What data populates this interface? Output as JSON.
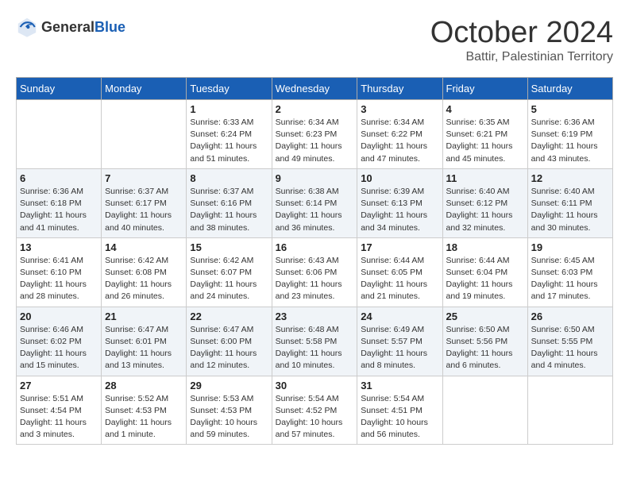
{
  "header": {
    "logo_general": "General",
    "logo_blue": "Blue",
    "month": "October 2024",
    "location": "Battir, Palestinian Territory"
  },
  "days_of_week": [
    "Sunday",
    "Monday",
    "Tuesday",
    "Wednesday",
    "Thursday",
    "Friday",
    "Saturday"
  ],
  "weeks": [
    {
      "days": [
        {
          "num": "",
          "empty": true
        },
        {
          "num": "",
          "empty": true
        },
        {
          "num": "1",
          "sunrise": "Sunrise: 6:33 AM",
          "sunset": "Sunset: 6:24 PM",
          "daylight": "Daylight: 11 hours and 51 minutes."
        },
        {
          "num": "2",
          "sunrise": "Sunrise: 6:34 AM",
          "sunset": "Sunset: 6:23 PM",
          "daylight": "Daylight: 11 hours and 49 minutes."
        },
        {
          "num": "3",
          "sunrise": "Sunrise: 6:34 AM",
          "sunset": "Sunset: 6:22 PM",
          "daylight": "Daylight: 11 hours and 47 minutes."
        },
        {
          "num": "4",
          "sunrise": "Sunrise: 6:35 AM",
          "sunset": "Sunset: 6:21 PM",
          "daylight": "Daylight: 11 hours and 45 minutes."
        },
        {
          "num": "5",
          "sunrise": "Sunrise: 6:36 AM",
          "sunset": "Sunset: 6:19 PM",
          "daylight": "Daylight: 11 hours and 43 minutes."
        }
      ]
    },
    {
      "days": [
        {
          "num": "6",
          "sunrise": "Sunrise: 6:36 AM",
          "sunset": "Sunset: 6:18 PM",
          "daylight": "Daylight: 11 hours and 41 minutes."
        },
        {
          "num": "7",
          "sunrise": "Sunrise: 6:37 AM",
          "sunset": "Sunset: 6:17 PM",
          "daylight": "Daylight: 11 hours and 40 minutes."
        },
        {
          "num": "8",
          "sunrise": "Sunrise: 6:37 AM",
          "sunset": "Sunset: 6:16 PM",
          "daylight": "Daylight: 11 hours and 38 minutes."
        },
        {
          "num": "9",
          "sunrise": "Sunrise: 6:38 AM",
          "sunset": "Sunset: 6:14 PM",
          "daylight": "Daylight: 11 hours and 36 minutes."
        },
        {
          "num": "10",
          "sunrise": "Sunrise: 6:39 AM",
          "sunset": "Sunset: 6:13 PM",
          "daylight": "Daylight: 11 hours and 34 minutes."
        },
        {
          "num": "11",
          "sunrise": "Sunrise: 6:40 AM",
          "sunset": "Sunset: 6:12 PM",
          "daylight": "Daylight: 11 hours and 32 minutes."
        },
        {
          "num": "12",
          "sunrise": "Sunrise: 6:40 AM",
          "sunset": "Sunset: 6:11 PM",
          "daylight": "Daylight: 11 hours and 30 minutes."
        }
      ]
    },
    {
      "days": [
        {
          "num": "13",
          "sunrise": "Sunrise: 6:41 AM",
          "sunset": "Sunset: 6:10 PM",
          "daylight": "Daylight: 11 hours and 28 minutes."
        },
        {
          "num": "14",
          "sunrise": "Sunrise: 6:42 AM",
          "sunset": "Sunset: 6:08 PM",
          "daylight": "Daylight: 11 hours and 26 minutes."
        },
        {
          "num": "15",
          "sunrise": "Sunrise: 6:42 AM",
          "sunset": "Sunset: 6:07 PM",
          "daylight": "Daylight: 11 hours and 24 minutes."
        },
        {
          "num": "16",
          "sunrise": "Sunrise: 6:43 AM",
          "sunset": "Sunset: 6:06 PM",
          "daylight": "Daylight: 11 hours and 23 minutes."
        },
        {
          "num": "17",
          "sunrise": "Sunrise: 6:44 AM",
          "sunset": "Sunset: 6:05 PM",
          "daylight": "Daylight: 11 hours and 21 minutes."
        },
        {
          "num": "18",
          "sunrise": "Sunrise: 6:44 AM",
          "sunset": "Sunset: 6:04 PM",
          "daylight": "Daylight: 11 hours and 19 minutes."
        },
        {
          "num": "19",
          "sunrise": "Sunrise: 6:45 AM",
          "sunset": "Sunset: 6:03 PM",
          "daylight": "Daylight: 11 hours and 17 minutes."
        }
      ]
    },
    {
      "days": [
        {
          "num": "20",
          "sunrise": "Sunrise: 6:46 AM",
          "sunset": "Sunset: 6:02 PM",
          "daylight": "Daylight: 11 hours and 15 minutes."
        },
        {
          "num": "21",
          "sunrise": "Sunrise: 6:47 AM",
          "sunset": "Sunset: 6:01 PM",
          "daylight": "Daylight: 11 hours and 13 minutes."
        },
        {
          "num": "22",
          "sunrise": "Sunrise: 6:47 AM",
          "sunset": "Sunset: 6:00 PM",
          "daylight": "Daylight: 11 hours and 12 minutes."
        },
        {
          "num": "23",
          "sunrise": "Sunrise: 6:48 AM",
          "sunset": "Sunset: 5:58 PM",
          "daylight": "Daylight: 11 hours and 10 minutes."
        },
        {
          "num": "24",
          "sunrise": "Sunrise: 6:49 AM",
          "sunset": "Sunset: 5:57 PM",
          "daylight": "Daylight: 11 hours and 8 minutes."
        },
        {
          "num": "25",
          "sunrise": "Sunrise: 6:50 AM",
          "sunset": "Sunset: 5:56 PM",
          "daylight": "Daylight: 11 hours and 6 minutes."
        },
        {
          "num": "26",
          "sunrise": "Sunrise: 6:50 AM",
          "sunset": "Sunset: 5:55 PM",
          "daylight": "Daylight: 11 hours and 4 minutes."
        }
      ]
    },
    {
      "days": [
        {
          "num": "27",
          "sunrise": "Sunrise: 5:51 AM",
          "sunset": "Sunset: 4:54 PM",
          "daylight": "Daylight: 11 hours and 3 minutes."
        },
        {
          "num": "28",
          "sunrise": "Sunrise: 5:52 AM",
          "sunset": "Sunset: 4:53 PM",
          "daylight": "Daylight: 11 hours and 1 minute."
        },
        {
          "num": "29",
          "sunrise": "Sunrise: 5:53 AM",
          "sunset": "Sunset: 4:53 PM",
          "daylight": "Daylight: 10 hours and 59 minutes."
        },
        {
          "num": "30",
          "sunrise": "Sunrise: 5:54 AM",
          "sunset": "Sunset: 4:52 PM",
          "daylight": "Daylight: 10 hours and 57 minutes."
        },
        {
          "num": "31",
          "sunrise": "Sunrise: 5:54 AM",
          "sunset": "Sunset: 4:51 PM",
          "daylight": "Daylight: 10 hours and 56 minutes."
        },
        {
          "num": "",
          "empty": true
        },
        {
          "num": "",
          "empty": true
        }
      ]
    }
  ]
}
